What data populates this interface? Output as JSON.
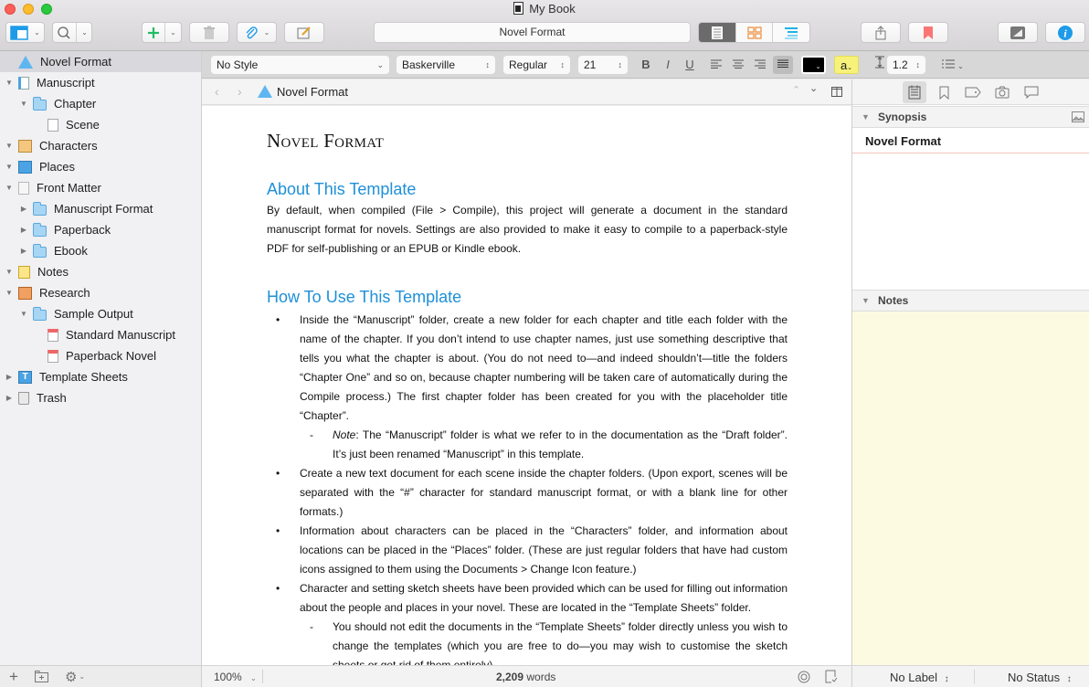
{
  "window": {
    "title": "My Book"
  },
  "toolbar": {
    "address_title": "Novel Format",
    "buttons": [
      {
        "name": "binder-toggle",
        "icon": "sidebar-icon"
      },
      {
        "name": "search",
        "icon": "search-icon"
      },
      {
        "name": "add",
        "icon": "plus-icon"
      },
      {
        "name": "trash",
        "icon": "trash-icon"
      },
      {
        "name": "attach",
        "icon": "paperclip-icon"
      },
      {
        "name": "compose",
        "icon": "compose-icon"
      },
      {
        "name": "share",
        "icon": "share-icon"
      },
      {
        "name": "bookmark",
        "icon": "bookmark-icon"
      },
      {
        "name": "composition-mode",
        "icon": "fullscreen-icon"
      },
      {
        "name": "inspector",
        "icon": "info-icon"
      }
    ],
    "view_modes": [
      "document",
      "corkboard",
      "outliner"
    ],
    "active_view_mode": "document"
  },
  "binder": {
    "items": [
      {
        "label": "Novel Format",
        "icon": "warning-info-icon",
        "level": 0,
        "disclosure": "none",
        "selected": true
      },
      {
        "label": "Manuscript",
        "icon": "manuscript-icon",
        "level": 0,
        "disclosure": "expanded"
      },
      {
        "label": "Chapter",
        "icon": "folder-icon",
        "level": 1,
        "disclosure": "expanded"
      },
      {
        "label": "Scene",
        "icon": "page-icon",
        "level": 2,
        "disclosure": "none"
      },
      {
        "label": "Characters",
        "icon": "characters-icon",
        "level": 0,
        "disclosure": "expanded"
      },
      {
        "label": "Places",
        "icon": "places-icon",
        "level": 0,
        "disclosure": "expanded"
      },
      {
        "label": "Front Matter",
        "icon": "front-matter-icon",
        "level": 0,
        "disclosure": "expanded"
      },
      {
        "label": "Manuscript Format",
        "icon": "folder-icon",
        "level": 1,
        "disclosure": "collapsed"
      },
      {
        "label": "Paperback",
        "icon": "folder-icon",
        "level": 1,
        "disclosure": "collapsed"
      },
      {
        "label": "Ebook",
        "icon": "folder-icon",
        "level": 1,
        "disclosure": "collapsed"
      },
      {
        "label": "Notes",
        "icon": "notes-icon",
        "level": 0,
        "disclosure": "expanded"
      },
      {
        "label": "Research",
        "icon": "research-icon",
        "level": 0,
        "disclosure": "expanded"
      },
      {
        "label": "Sample Output",
        "icon": "folder-icon",
        "level": 1,
        "disclosure": "expanded"
      },
      {
        "label": "Standard Manuscript",
        "icon": "pdf-icon",
        "level": 2,
        "disclosure": "none"
      },
      {
        "label": "Paperback Novel",
        "icon": "pdf-icon",
        "level": 2,
        "disclosure": "none"
      },
      {
        "label": "Template Sheets",
        "icon": "template-sheets-icon",
        "level": 0,
        "disclosure": "collapsed"
      },
      {
        "label": "Trash",
        "icon": "trash-icon",
        "level": 0,
        "disclosure": "collapsed"
      }
    ],
    "footer_icons": [
      "plus-icon",
      "new-folder-icon",
      "gear-icon"
    ]
  },
  "format_bar": {
    "style": "No Style",
    "font": "Baskerville",
    "weight": "Regular",
    "size": "21",
    "bold": "B",
    "italic": "I",
    "underline": "U",
    "alignment_active": "justify",
    "text_color": "#000000",
    "highlight_label": "a",
    "highlight_color": "#f7f27a",
    "line_spacing": "1.2"
  },
  "editor": {
    "header_title": "Novel Format",
    "doc_title": "Novel Format",
    "sections": [
      {
        "heading": "About This Template",
        "paragraph": "By default, when compiled (File > Compile), this project will generate a document in the standard manuscript format for novels. Settings are also provided to make it easy to compile to a paperback-style PDF for self-publishing or an EPUB or Kindle ebook."
      },
      {
        "heading": "How To Use This Template",
        "bullets": [
          "Inside the “Manuscript” folder, create a new folder for each chapter and title each folder with the name of the chapter. If you don’t intend to use chapter names, just use something descriptive that tells you what the chapter is about. (You do not need to—and indeed shouldn’t—title the folders “Chapter One” and so on, because chapter numbering will be taken care of automatically during the Compile process.) The first chapter folder has been created for you with the placeholder title “Chapter”.",
          "Create a new text document for each scene inside the chapter folders. (Upon export, scenes will be separated with the “#” character for standard manuscript format, or with a blank line for other formats.)",
          "Information about characters can be placed in the “Characters” folder, and information about locations can be placed in the “Places” folder. (These are just regular folders that have had custom icons assigned to them using the Documents > Change Icon feature.)",
          "Character and setting sketch sheets have been provided which can be used for filling out information about the people and places in your novel. These are located in the “Template Sheets” folder."
        ],
        "note_label": "Note",
        "note_text": ": The “Manuscript” folder is what we refer to in the documentation as the “Draft folder”. It’s just been renamed “Manuscript” in this template.",
        "sub_bullet": "You should not edit the documents in the “Template Sheets” folder directly unless you wish to change the templates (which you are free to do—you may wish to customise the sketch sheets or get rid of them entirely)."
      }
    ],
    "zoom": "100%",
    "word_count": "2,209",
    "word_label": "words"
  },
  "inspector": {
    "tabs": [
      "notes-icon",
      "bookmark-icon",
      "tag-icon",
      "snapshot-icon",
      "comment-icon"
    ],
    "active_tab": 0,
    "synopsis_label": "Synopsis",
    "synopsis_title": "Novel Format",
    "notes_label": "Notes",
    "label_value": "No Label",
    "status_value": "No Status"
  }
}
